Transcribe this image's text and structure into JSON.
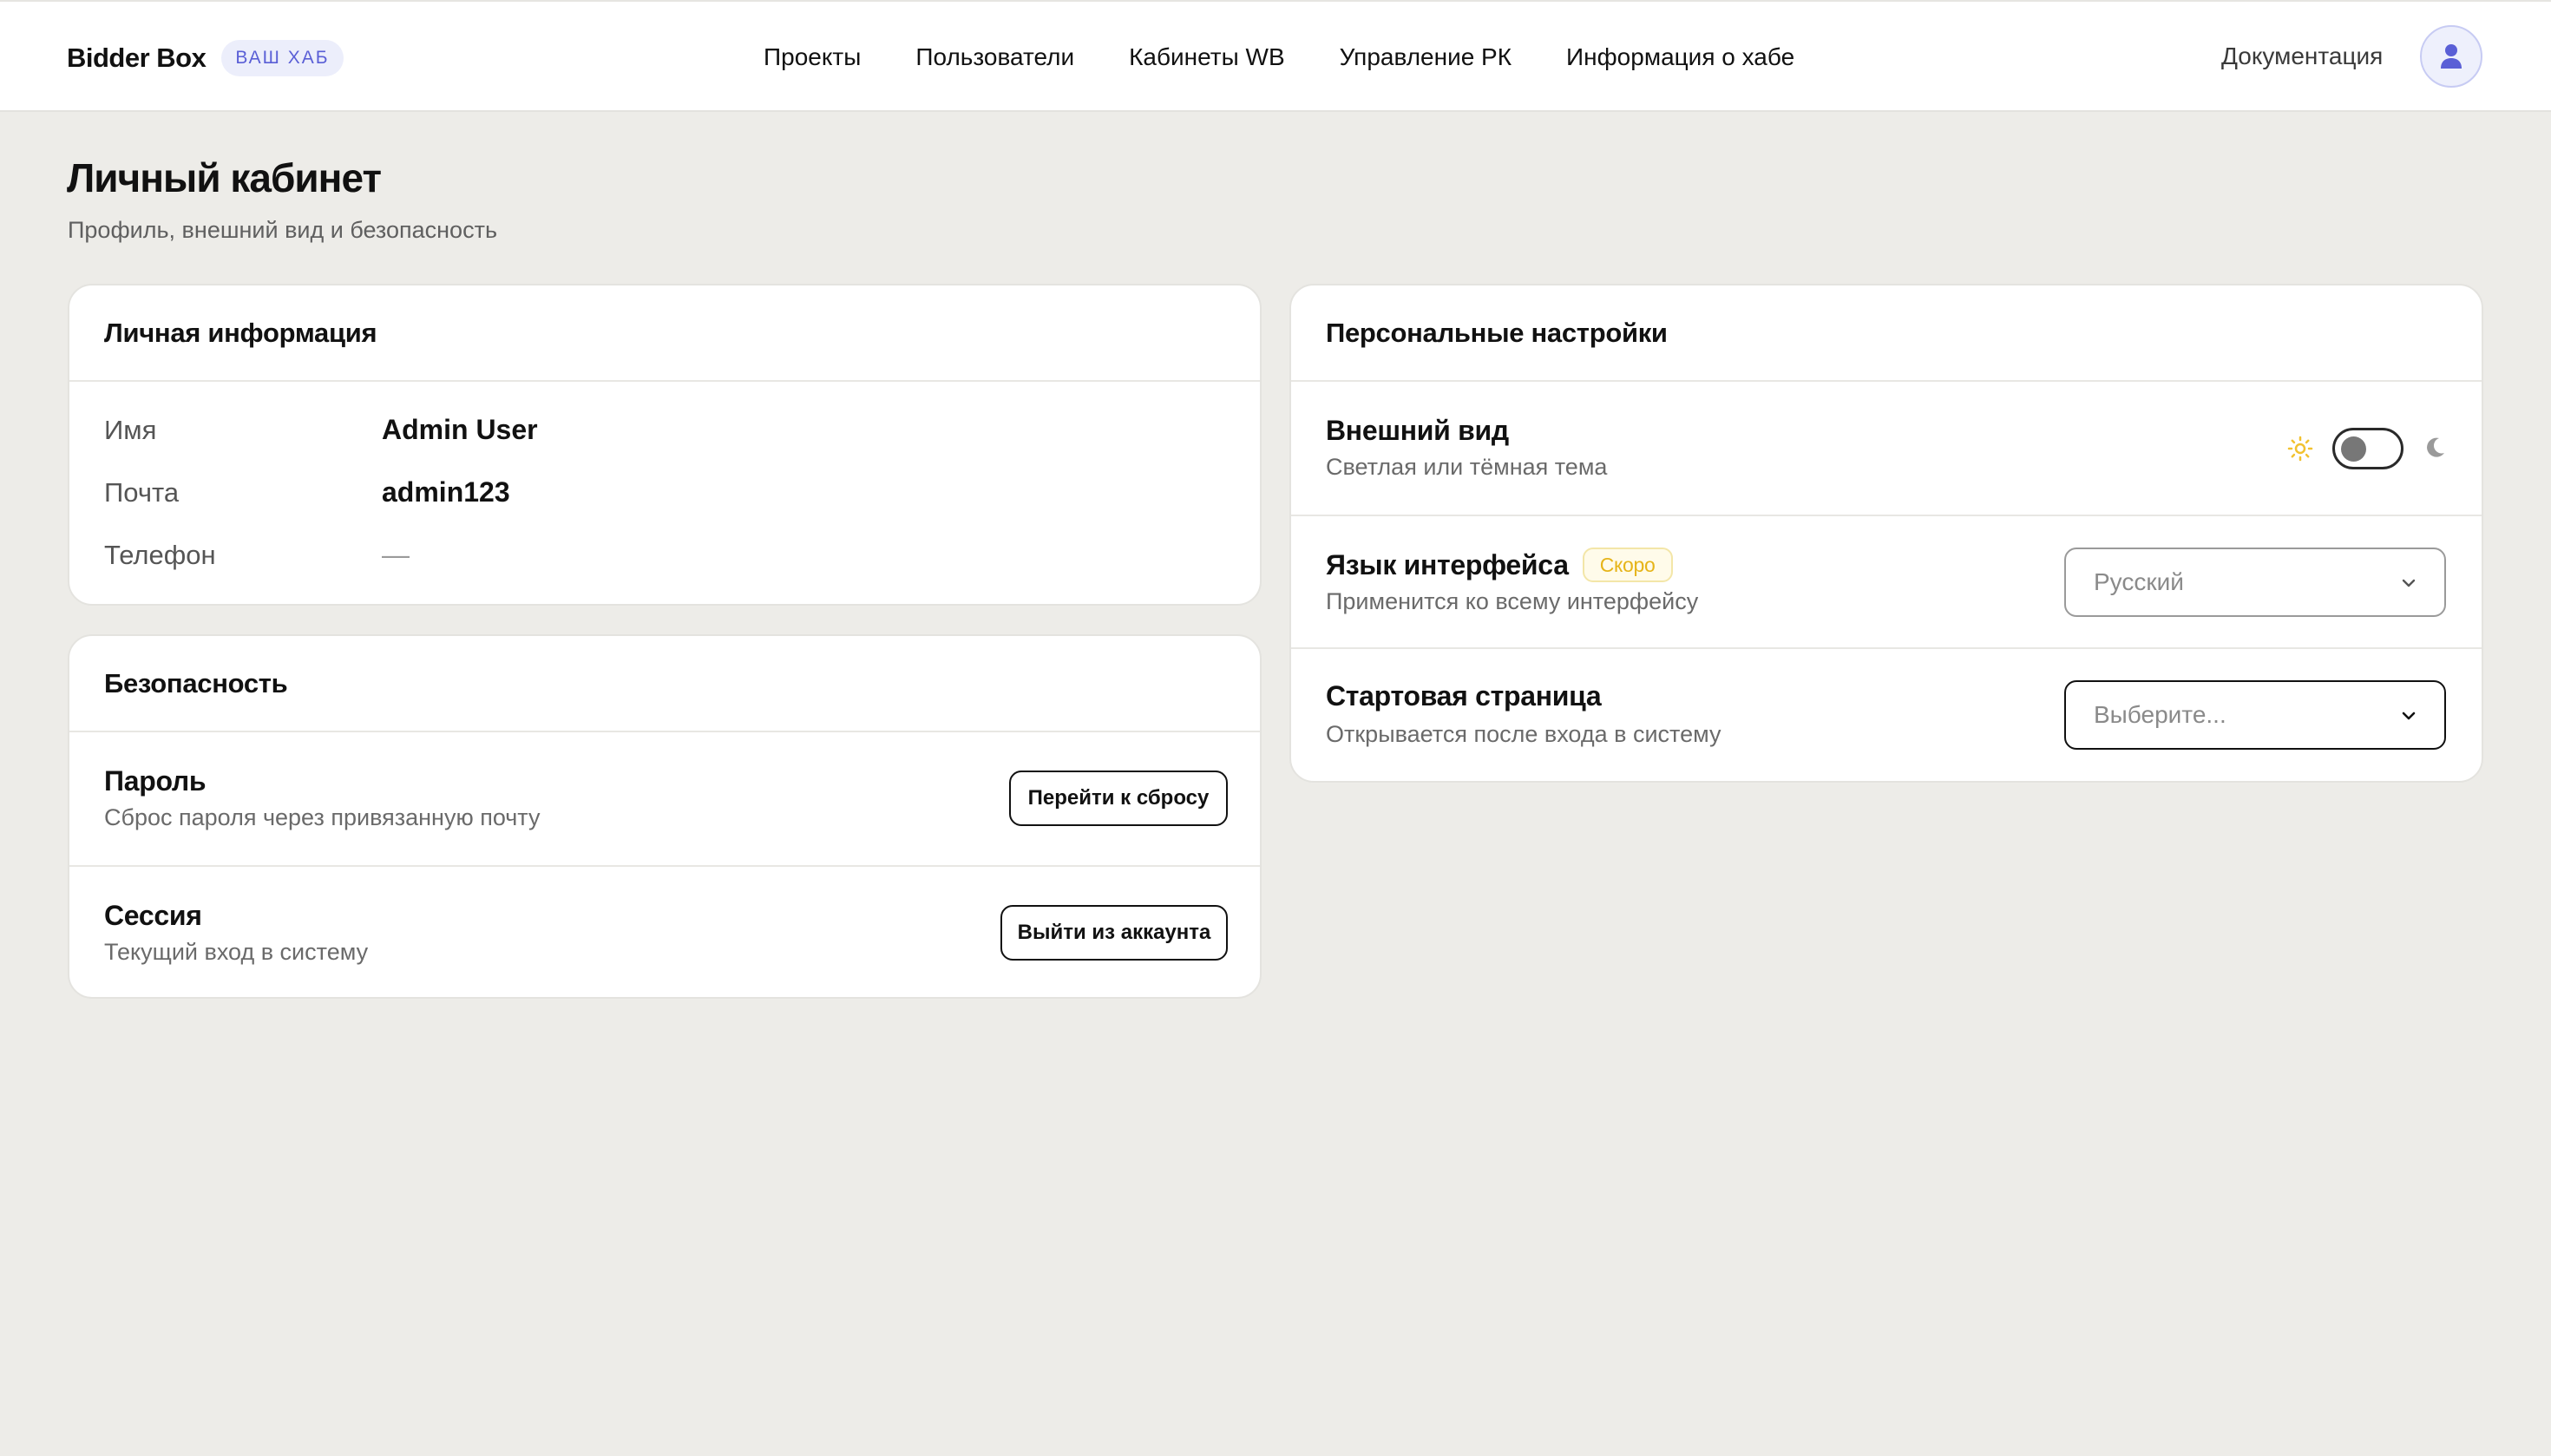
{
  "header": {
    "brand": "Bidder Box",
    "badge": "ВАШ ХАБ",
    "nav": [
      "Проекты",
      "Пользователи",
      "Кабинеты WB",
      "Управление РК",
      "Информация о хабе"
    ],
    "docs": "Документация",
    "avatar_icon": "user-icon"
  },
  "page": {
    "title": "Личный кабинет",
    "subtitle": "Профиль, внешний вид и безопасность"
  },
  "personal_info": {
    "title": "Личная информация",
    "rows": [
      {
        "label": "Имя",
        "value": "Admin User"
      },
      {
        "label": "Почта",
        "value": "admin123"
      },
      {
        "label": "Телефон",
        "value": "—"
      }
    ]
  },
  "security": {
    "title": "Безопасность",
    "password": {
      "title": "Пароль",
      "desc": "Сброс пароля через привязанную почту",
      "button": "Перейти к сбросу"
    },
    "session": {
      "title": "Сессия",
      "desc": "Текущий вход в систему",
      "button": "Выйти из аккаунта"
    }
  },
  "settings": {
    "title": "Персональные настройки",
    "appearance": {
      "title": "Внешний вид",
      "desc": "Светлая или тёмная тема",
      "dark_mode": false
    },
    "language": {
      "title": "Язык интерфейса",
      "badge": "Скоро",
      "desc": "Применится ко всему интерфейсу",
      "value": "Русский"
    },
    "start_page": {
      "title": "Стартовая страница",
      "desc": "Открывается после входа в систему",
      "placeholder": "Выберите..."
    }
  },
  "colors": {
    "accent": "#5a5fd6",
    "background": "#edece8",
    "sun": "#f2c230",
    "soon": "#e6b419"
  }
}
